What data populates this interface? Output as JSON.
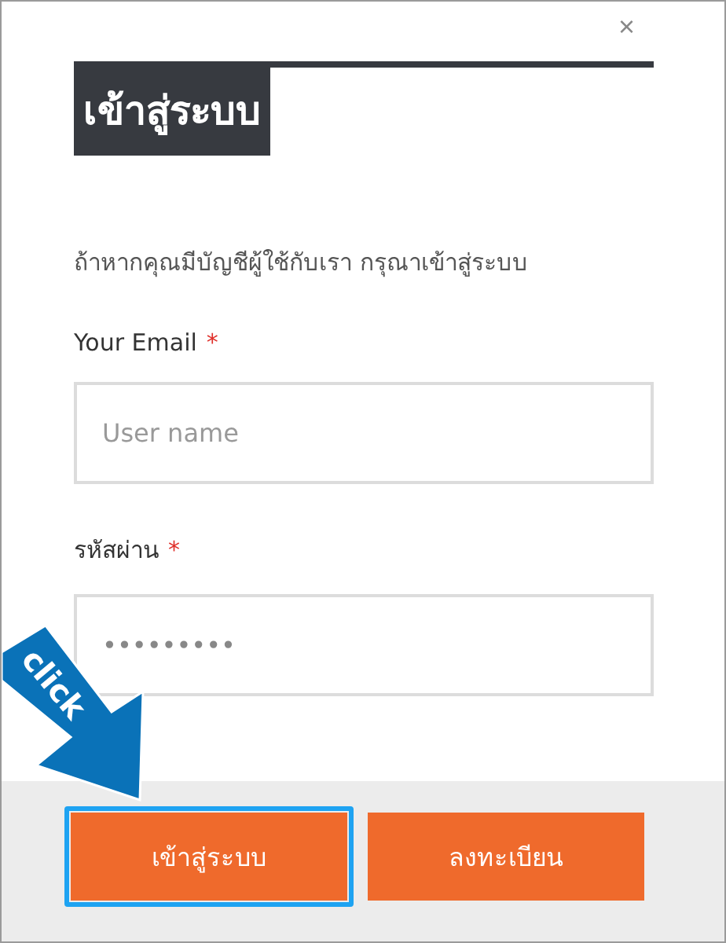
{
  "dialog": {
    "close": "×",
    "title": "เข้าสู่ระบบ",
    "description": "ถ้าหากคุณมีบัญชีผู้ใช้กับเรา กรุณาเข้าสู่ระบบ",
    "fields": [
      {
        "label": "Your Email",
        "required_mark": "*",
        "placeholder": "User name"
      },
      {
        "label": "รหัสผ่าน",
        "required_mark": "*",
        "value": "•••••••••"
      }
    ],
    "buttons": [
      {
        "label": "เข้าสู่ระบบ",
        "focused": true
      },
      {
        "label": "ลงทะเบียน",
        "focused": false
      }
    ]
  },
  "annotation": {
    "text": "click"
  }
}
